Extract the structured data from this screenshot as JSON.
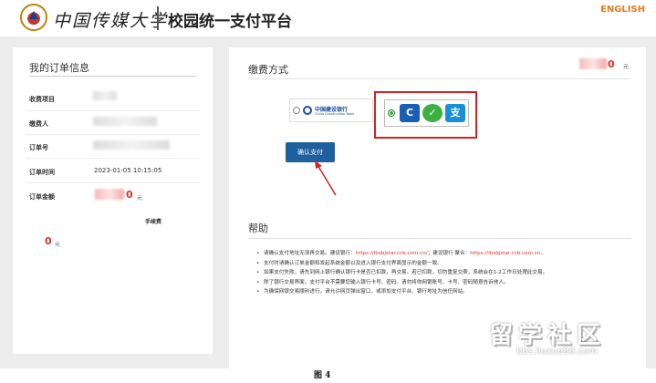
{
  "header": {
    "logo_text": "中国传媒大学",
    "platform_title": "校园统一支付平台",
    "language_link": "ENGLISH"
  },
  "order_panel": {
    "title": "我的订单信息",
    "rows": [
      {
        "label": "收费项目"
      },
      {
        "label": "缴费人"
      },
      {
        "label": "订单号"
      },
      {
        "label": "订单时间",
        "value": "2023-01-05 10:15:05"
      },
      {
        "label": "订单金额",
        "amount": "0",
        "unit": "元"
      }
    ],
    "fee_label": "手续费",
    "fee_amount": "0",
    "fee_unit": "元"
  },
  "payment_panel": {
    "title": "缴费方式",
    "amount": "0",
    "unit": "元",
    "confirm_button": "确认支付",
    "bank_option": {
      "name_cn": "中国建设银行",
      "name_en": "China Construction Bank",
      "selected": false
    },
    "combined_option": {
      "icons": [
        "ccb-icon",
        "wechat-pay-icon",
        "alipay-icon"
      ],
      "selected": true
    }
  },
  "help": {
    "title": "帮助",
    "items": [
      {
        "text": "请确认支付地址无误再交易。建设银行：",
        "url1": "https://ibsbjstar.ccb.com.cn/",
        "mid": "；建设银行 聚合：",
        "url2": "https://ibsbjstar.ccb.com.cn。"
      },
      {
        "text": "支付时请确认订单金额和发起系统金额以及进入银行支付界面显示的金额一致。"
      },
      {
        "text": "如果支付失败，请先到网上银行确认银行卡是否已扣款，再交易。若已扣款，切勿重复交费，系统会在1-2工作日处理此交易。"
      },
      {
        "text": "除了银行交易界面，支付平台不需要您输入银行卡号、密码。请勿将你网银账号、卡号、密码随意告诉他人。"
      },
      {
        "text": "为确保网银交易顺利进行，请允许网页弹出窗口，或添加支付平台、银行地址为信任网站。"
      }
    ]
  },
  "watermark": {
    "text": "留学社区",
    "url": "bbs.liuxue86.com"
  },
  "caption": "图 4",
  "colors": {
    "accent_orange": "#e87a1d",
    "button_blue": "#1e5f9e",
    "amount_red": "#d9332b",
    "highlight_red": "#d62020"
  }
}
